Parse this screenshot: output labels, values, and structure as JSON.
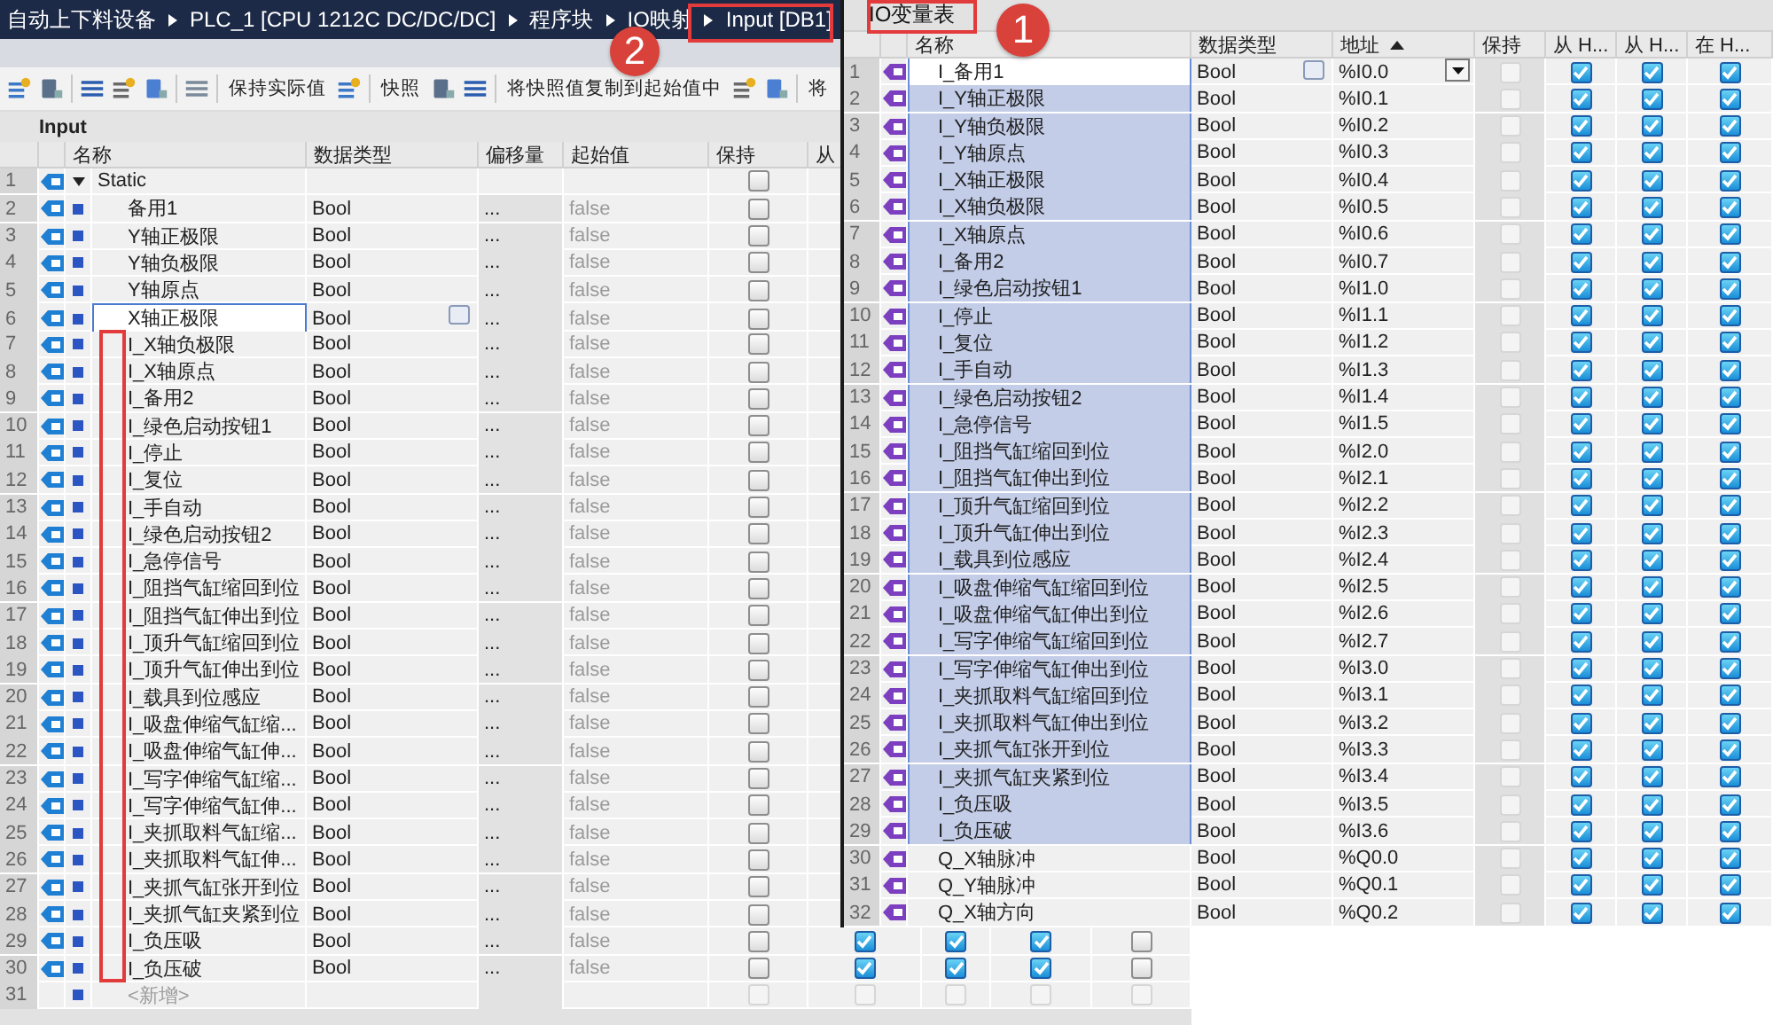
{
  "breadcrumb": [
    "自动上下料设备",
    "PLC_1 [CPU 1212C DC/DC/DC]",
    "程序块",
    "IO映射",
    "Input [DB1]"
  ],
  "toolbar": [
    "保持实际值",
    "快照",
    "将快照值复制到起始值中",
    "将"
  ],
  "block_title": "Input",
  "table": {
    "columns": [
      "名称",
      "数据类型",
      "偏移量",
      "起始值",
      "保持",
      "从"
    ],
    "rows": [
      {
        "number": "1",
        "name": "Static",
        "expanded": true,
        "retain": false,
        "children": [
          {
            "number": "2",
            "name": "备用1",
            "type": "Bool",
            "offset": "...",
            "start": "false",
            "retain": false,
            "selected": false
          },
          {
            "number": "3",
            "name": "Y轴正极限",
            "type": "Bool",
            "offset": "...",
            "start": "false",
            "retain": false,
            "selected": false
          },
          {
            "number": "4",
            "name": "Y轴负极限",
            "type": "Bool",
            "offset": "...",
            "start": "false",
            "retain": false,
            "selected": false
          },
          {
            "number": "5",
            "name": "Y轴原点",
            "type": "Bool",
            "offset": "...",
            "start": "false",
            "retain": false,
            "selected": false
          },
          {
            "number": "6",
            "name": "X轴正极限",
            "type": "Bool",
            "offset": "...",
            "start": "false",
            "retain": false,
            "selected": true
          },
          {
            "number": "7",
            "name": "I_X轴负极限",
            "type": "Bool",
            "offset": "...",
            "start": "false",
            "retain": false,
            "selected": false
          },
          {
            "number": "8",
            "name": "I_X轴原点",
            "type": "Bool",
            "offset": "...",
            "start": "false",
            "retain": false,
            "selected": false
          },
          {
            "number": "9",
            "name": "I_备用2",
            "type": "Bool",
            "offset": "...",
            "start": "false",
            "retain": false,
            "selected": false
          },
          {
            "number": "10",
            "name": "I_绿色启动按钮1",
            "type": "Bool",
            "offset": "...",
            "start": "false",
            "retain": false,
            "selected": false
          },
          {
            "number": "11",
            "name": "I_停止",
            "type": "Bool",
            "offset": "...",
            "start": "false",
            "retain": false,
            "selected": false
          },
          {
            "number": "12",
            "name": "I_复位",
            "type": "Bool",
            "offset": "...",
            "start": "false",
            "retain": false,
            "selected": false
          },
          {
            "number": "13",
            "name": "I_手自动",
            "type": "Bool",
            "offset": "...",
            "start": "false",
            "retain": false,
            "selected": false
          },
          {
            "number": "14",
            "name": "I_绿色启动按钮2",
            "type": "Bool",
            "offset": "...",
            "start": "false",
            "retain": false,
            "selected": false
          },
          {
            "number": "15",
            "name": "I_急停信号",
            "type": "Bool",
            "offset": "...",
            "start": "false",
            "retain": false,
            "selected": false
          },
          {
            "number": "16",
            "name": "I_阻挡气缸缩回到位",
            "type": "Bool",
            "offset": "...",
            "start": "false",
            "retain": false,
            "selected": false
          },
          {
            "number": "17",
            "name": "I_阻挡气缸伸出到位",
            "type": "Bool",
            "offset": "...",
            "start": "false",
            "retain": false,
            "selected": false
          },
          {
            "number": "18",
            "name": "I_顶升气缸缩回到位",
            "type": "Bool",
            "offset": "...",
            "start": "false",
            "retain": false,
            "selected": false
          },
          {
            "number": "19",
            "name": "I_顶升气缸伸出到位",
            "type": "Bool",
            "offset": "...",
            "start": "false",
            "retain": false,
            "selected": false
          },
          {
            "number": "20",
            "name": "I_载具到位感应",
            "type": "Bool",
            "offset": "...",
            "start": "false",
            "retain": false,
            "selected": false
          },
          {
            "number": "21",
            "name": "I_吸盘伸缩气缸缩...",
            "type": "Bool",
            "offset": "...",
            "start": "false",
            "retain": false,
            "selected": false
          },
          {
            "number": "22",
            "name": "I_吸盘伸缩气缸伸...",
            "type": "Bool",
            "offset": "...",
            "start": "false",
            "retain": false,
            "selected": false
          },
          {
            "number": "23",
            "name": "I_写字伸缩气缸缩...",
            "type": "Bool",
            "offset": "...",
            "start": "false",
            "retain": false,
            "selected": false
          },
          {
            "number": "24",
            "name": "I_写字伸缩气缸伸...",
            "type": "Bool",
            "offset": "...",
            "start": "false",
            "retain": false,
            "selected": false
          },
          {
            "number": "25",
            "name": "I_夹抓取料气缸缩...",
            "type": "Bool",
            "offset": "...",
            "start": "false",
            "retain": false,
            "selected": false
          },
          {
            "number": "26",
            "name": "I_夹抓取料气缸伸...",
            "type": "Bool",
            "offset": "...",
            "start": "false",
            "retain": false,
            "selected": false
          },
          {
            "number": "27",
            "name": "I_夹抓气缸张开到位",
            "type": "Bool",
            "offset": "...",
            "start": "false",
            "retain": false,
            "selected": false
          },
          {
            "number": "28",
            "name": "I_夹抓气缸夹紧到位",
            "type": "Bool",
            "offset": "...",
            "start": "false",
            "retain": false,
            "selected": false
          },
          {
            "number": "29",
            "name": "I_负压吸",
            "type": "Bool",
            "offset": "...",
            "start": "false",
            "retain": false,
            "selected": false,
            "flags": [
              true,
              true,
              true,
              false
            ]
          },
          {
            "number": "30",
            "name": "I_负压破",
            "type": "Bool",
            "offset": "...",
            "start": "false",
            "retain": false,
            "selected": false,
            "flags": [
              true,
              true,
              true,
              false
            ]
          }
        ]
      }
    ],
    "new_row": {
      "number": "31",
      "label": "<新增>",
      "disabled": true,
      "retain": false,
      "flags": [
        false,
        false,
        false,
        false
      ]
    }
  },
  "io_table": {
    "title": "IO变量表",
    "columns": [
      "名称",
      "数据类型",
      "地址",
      "保持",
      "从 H...",
      "从 H...",
      "在 H..."
    ],
    "rows": [
      {
        "number": "1",
        "name": "I_备用1",
        "type": "Bool",
        "address": "%I0.0",
        "retain": false,
        "flags": [
          true,
          true,
          true
        ],
        "selected": true,
        "focused": true
      },
      {
        "number": "2",
        "name": "I_Y轴正极限",
        "type": "Bool",
        "address": "%I0.1",
        "retain": false,
        "flags": [
          true,
          true,
          true
        ],
        "selected": true,
        "focused": false
      },
      {
        "number": "3",
        "name": "I_Y轴负极限",
        "type": "Bool",
        "address": "%I0.2",
        "retain": false,
        "flags": [
          true,
          true,
          true
        ],
        "selected": true,
        "focused": false
      },
      {
        "number": "4",
        "name": "I_Y轴原点",
        "type": "Bool",
        "address": "%I0.3",
        "retain": false,
        "flags": [
          true,
          true,
          true
        ],
        "selected": true,
        "focused": false
      },
      {
        "number": "5",
        "name": "I_X轴正极限",
        "type": "Bool",
        "address": "%I0.4",
        "retain": false,
        "flags": [
          true,
          true,
          true
        ],
        "selected": true,
        "focused": false
      },
      {
        "number": "6",
        "name": "I_X轴负极限",
        "type": "Bool",
        "address": "%I0.5",
        "retain": false,
        "flags": [
          true,
          true,
          true
        ],
        "selected": true,
        "focused": false
      },
      {
        "number": "7",
        "name": "I_X轴原点",
        "type": "Bool",
        "address": "%I0.6",
        "retain": false,
        "flags": [
          true,
          true,
          true
        ],
        "selected": true,
        "focused": false
      },
      {
        "number": "8",
        "name": "I_备用2",
        "type": "Bool",
        "address": "%I0.7",
        "retain": false,
        "flags": [
          true,
          true,
          true
        ],
        "selected": true,
        "focused": false
      },
      {
        "number": "9",
        "name": "I_绿色启动按钮1",
        "type": "Bool",
        "address": "%I1.0",
        "retain": false,
        "flags": [
          true,
          true,
          true
        ],
        "selected": true,
        "focused": false
      },
      {
        "number": "10",
        "name": "I_停止",
        "type": "Bool",
        "address": "%I1.1",
        "retain": false,
        "flags": [
          true,
          true,
          true
        ],
        "selected": true,
        "focused": false
      },
      {
        "number": "11",
        "name": "I_复位",
        "type": "Bool",
        "address": "%I1.2",
        "retain": false,
        "flags": [
          true,
          true,
          true
        ],
        "selected": true,
        "focused": false
      },
      {
        "number": "12",
        "name": "I_手自动",
        "type": "Bool",
        "address": "%I1.3",
        "retain": false,
        "flags": [
          true,
          true,
          true
        ],
        "selected": true,
        "focused": false
      },
      {
        "number": "13",
        "name": "I_绿色启动按钮2",
        "type": "Bool",
        "address": "%I1.4",
        "retain": false,
        "flags": [
          true,
          true,
          true
        ],
        "selected": true,
        "focused": false
      },
      {
        "number": "14",
        "name": "I_急停信号",
        "type": "Bool",
        "address": "%I1.5",
        "retain": false,
        "flags": [
          true,
          true,
          true
        ],
        "selected": true,
        "focused": false
      },
      {
        "number": "15",
        "name": "I_阻挡气缸缩回到位",
        "type": "Bool",
        "address": "%I2.0",
        "retain": false,
        "flags": [
          true,
          true,
          true
        ],
        "selected": true,
        "focused": false
      },
      {
        "number": "16",
        "name": "I_阻挡气缸伸出到位",
        "type": "Bool",
        "address": "%I2.1",
        "retain": false,
        "flags": [
          true,
          true,
          true
        ],
        "selected": true,
        "focused": false
      },
      {
        "number": "17",
        "name": "I_顶升气缸缩回到位",
        "type": "Bool",
        "address": "%I2.2",
        "retain": false,
        "flags": [
          true,
          true,
          true
        ],
        "selected": true,
        "focused": false
      },
      {
        "number": "18",
        "name": "I_顶升气缸伸出到位",
        "type": "Bool",
        "address": "%I2.3",
        "retain": false,
        "flags": [
          true,
          true,
          true
        ],
        "selected": true,
        "focused": false
      },
      {
        "number": "19",
        "name": "I_载具到位感应",
        "type": "Bool",
        "address": "%I2.4",
        "retain": false,
        "flags": [
          true,
          true,
          true
        ],
        "selected": true,
        "focused": false
      },
      {
        "number": "20",
        "name": "I_吸盘伸缩气缸缩回到位",
        "type": "Bool",
        "address": "%I2.5",
        "retain": false,
        "flags": [
          true,
          true,
          true
        ],
        "selected": true,
        "focused": false
      },
      {
        "number": "21",
        "name": "I_吸盘伸缩气缸伸出到位",
        "type": "Bool",
        "address": "%I2.6",
        "retain": false,
        "flags": [
          true,
          true,
          true
        ],
        "selected": true,
        "focused": false
      },
      {
        "number": "22",
        "name": "I_写字伸缩气缸缩回到位",
        "type": "Bool",
        "address": "%I2.7",
        "retain": false,
        "flags": [
          true,
          true,
          true
        ],
        "selected": true,
        "focused": false
      },
      {
        "number": "23",
        "name": "I_写字伸缩气缸伸出到位",
        "type": "Bool",
        "address": "%I3.0",
        "retain": false,
        "flags": [
          true,
          true,
          true
        ],
        "selected": true,
        "focused": false
      },
      {
        "number": "24",
        "name": "I_夹抓取料气缸缩回到位",
        "type": "Bool",
        "address": "%I3.1",
        "retain": false,
        "flags": [
          true,
          true,
          true
        ],
        "selected": true,
        "focused": false
      },
      {
        "number": "25",
        "name": "I_夹抓取料气缸伸出到位",
        "type": "Bool",
        "address": "%I3.2",
        "retain": false,
        "flags": [
          true,
          true,
          true
        ],
        "selected": true,
        "focused": false
      },
      {
        "number": "26",
        "name": "I_夹抓气缸张开到位",
        "type": "Bool",
        "address": "%I3.3",
        "retain": false,
        "flags": [
          true,
          true,
          true
        ],
        "selected": true,
        "focused": false
      },
      {
        "number": "27",
        "name": "I_夹抓气缸夹紧到位",
        "type": "Bool",
        "address": "%I3.4",
        "retain": false,
        "flags": [
          true,
          true,
          true
        ],
        "selected": true,
        "focused": false
      },
      {
        "number": "28",
        "name": "I_负压吸",
        "type": "Bool",
        "address": "%I3.5",
        "retain": false,
        "flags": [
          true,
          true,
          true
        ],
        "selected": true,
        "focused": false
      },
      {
        "number": "29",
        "name": "I_负压破",
        "type": "Bool",
        "address": "%I3.6",
        "retain": false,
        "flags": [
          true,
          true,
          true
        ],
        "selected": true,
        "focused": false
      },
      {
        "number": "30",
        "name": "Q_X轴脉冲",
        "type": "Bool",
        "address": "%Q0.0",
        "retain": false,
        "flags": [
          true,
          true,
          true
        ],
        "selected": false,
        "focused": false
      },
      {
        "number": "31",
        "name": "Q_Y轴脉冲",
        "type": "Bool",
        "address": "%Q0.1",
        "retain": false,
        "flags": [
          true,
          true,
          true
        ],
        "selected": false,
        "focused": false
      },
      {
        "number": "32",
        "name": "Q_X轴方向",
        "type": "Bool",
        "address": "%Q0.2",
        "retain": false,
        "flags": [
          true,
          true,
          true
        ],
        "selected": false,
        "focused": false
      }
    ]
  },
  "annotations": [
    {
      "label": "2"
    },
    {
      "label": "1"
    }
  ]
}
